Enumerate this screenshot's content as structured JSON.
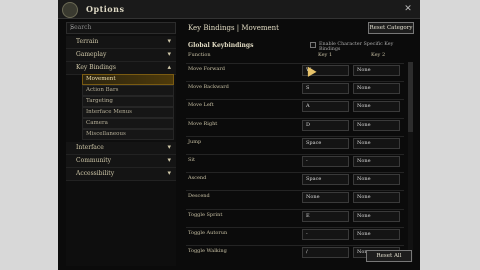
{
  "window": {
    "title": "Options",
    "close_glyph": "✕"
  },
  "search": {
    "placeholder": "Search",
    "icon": "search-icon"
  },
  "sidebar": {
    "categories": [
      {
        "label": "Terrain",
        "chevron": "▾"
      },
      {
        "label": "Gameplay",
        "chevron": "▾"
      },
      {
        "label": "Key Bindings",
        "chevron": "▴"
      },
      {
        "label": "Interface",
        "chevron": "▾"
      },
      {
        "label": "Community",
        "chevron": "▾"
      },
      {
        "label": "Accessibility",
        "chevron": "▾"
      }
    ],
    "subitems": [
      {
        "label": "Movement",
        "selected": true
      },
      {
        "label": "Action Bars"
      },
      {
        "label": "Targeting"
      },
      {
        "label": "Interface Menus"
      },
      {
        "label": "Camera"
      },
      {
        "label": "Miscellaneous"
      }
    ]
  },
  "main": {
    "header": "Key Bindings | Movement",
    "reset_category": "Reset Category",
    "section_title": "Global Keybindings",
    "char_specific_label": "Enable Character Specific Key Bindings",
    "columns": {
      "function": "Function",
      "key1": "Key 1",
      "key2": "Key 2"
    },
    "rows": [
      {
        "fn": "Move Forward",
        "k1": "W",
        "k2": "None"
      },
      {
        "fn": "Move Backward",
        "k1": "S",
        "k2": "None"
      },
      {
        "fn": "Move Left",
        "k1": "A",
        "k2": "None"
      },
      {
        "fn": "Move Right",
        "k1": "D",
        "k2": "None"
      },
      {
        "fn": "Jump",
        "k1": "Space",
        "k2": "None"
      },
      {
        "fn": "Sit",
        "k1": "-",
        "k2": "None"
      },
      {
        "fn": "Ascend",
        "k1": "Space",
        "k2": "None"
      },
      {
        "fn": "Descend",
        "k1": "None",
        "k2": "None"
      },
      {
        "fn": "Toggle Sprint",
        "k1": "E",
        "k2": "None"
      },
      {
        "fn": "Toggle Autorun",
        "k1": "-",
        "k2": "None"
      },
      {
        "fn": "Toggle Walking",
        "k1": "/",
        "k2": "None"
      }
    ],
    "reset_all": "Reset All"
  },
  "colors": {
    "accent": "#7a5b12",
    "text": "#c8c0a4",
    "background": "#0b0b0b"
  }
}
